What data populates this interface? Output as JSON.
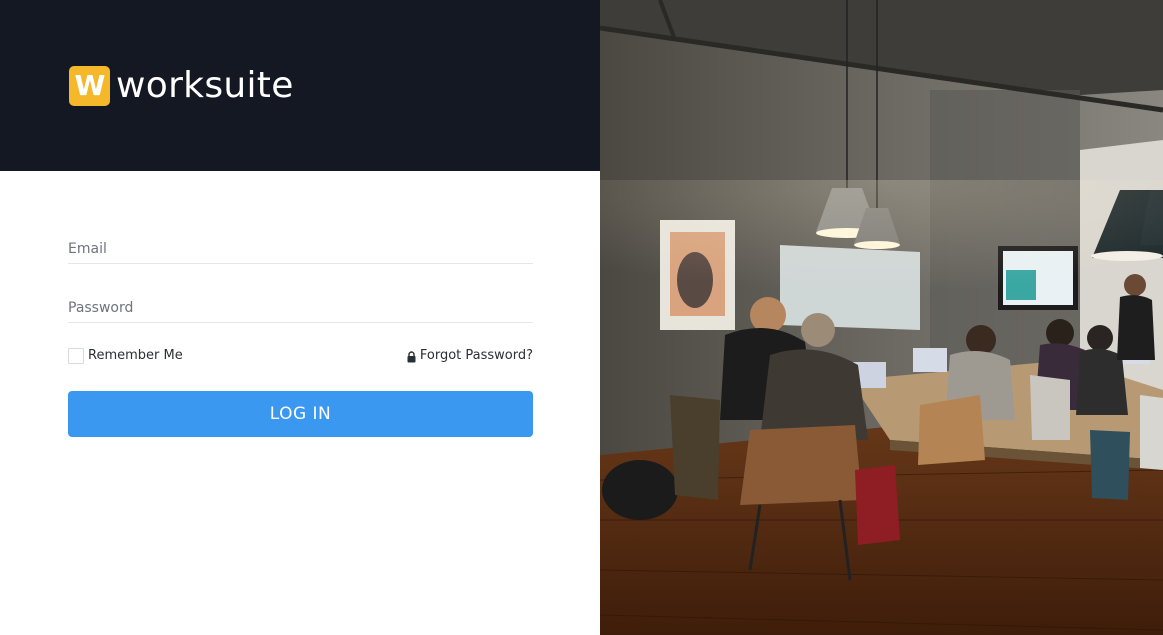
{
  "brand": {
    "logo_letter": "W",
    "name": "worksuite",
    "header_color": "#141822",
    "logo_color": "#f5b82a"
  },
  "login": {
    "email_placeholder": "Email",
    "password_placeholder": "Password",
    "remember_label": "Remember Me",
    "forgot_label": "Forgot Password?",
    "login_button": "LOG IN",
    "button_color": "#3a98f0"
  },
  "photo": {
    "description_icon": "office-workspace-photo"
  }
}
